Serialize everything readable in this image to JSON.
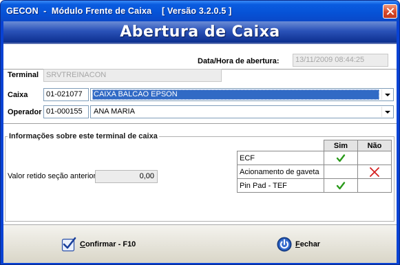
{
  "window": {
    "title": "GECON  -  Módulo Frente de Caixa    [ Versão 3.2.0.5 ]"
  },
  "header": {
    "title": "Abertura de Caixa"
  },
  "form": {
    "opening_datetime_label": "Data/Hora de abertura:",
    "opening_datetime_value": "13/11/2009 08:44:25",
    "terminal_label": "Terminal",
    "terminal_value": "SRVTREINACON",
    "caixa_label": "Caixa",
    "caixa_code": "01-021077",
    "caixa_selected": "CAIXA BALCAO EPSON",
    "operador_label": "Operador",
    "operador_code": "01-000155",
    "operador_selected": "ANA MARIA"
  },
  "terminal_info": {
    "group_title": "Informações sobre este terminal de caixa",
    "retained_label": "Valor retido seção anterior",
    "retained_value": "0,00",
    "columns": {
      "yes": "Sim",
      "no": "Não"
    },
    "rows": [
      {
        "name": "ECF",
        "yes": true,
        "no": false
      },
      {
        "name": "Acionamento de gaveta",
        "yes": false,
        "no": true
      },
      {
        "name": "Pin Pad - TEF",
        "yes": true,
        "no": false
      }
    ]
  },
  "footer": {
    "confirm_hotkey_letter": "C",
    "confirm_rest": "onfirmar - F10",
    "close_hotkey_letter": "F",
    "close_rest": "echar"
  },
  "colors": {
    "title_bar": "#0652d6",
    "selection": "#316ac5",
    "check_green": "#2a9a1a",
    "cross_red": "#d42020"
  }
}
